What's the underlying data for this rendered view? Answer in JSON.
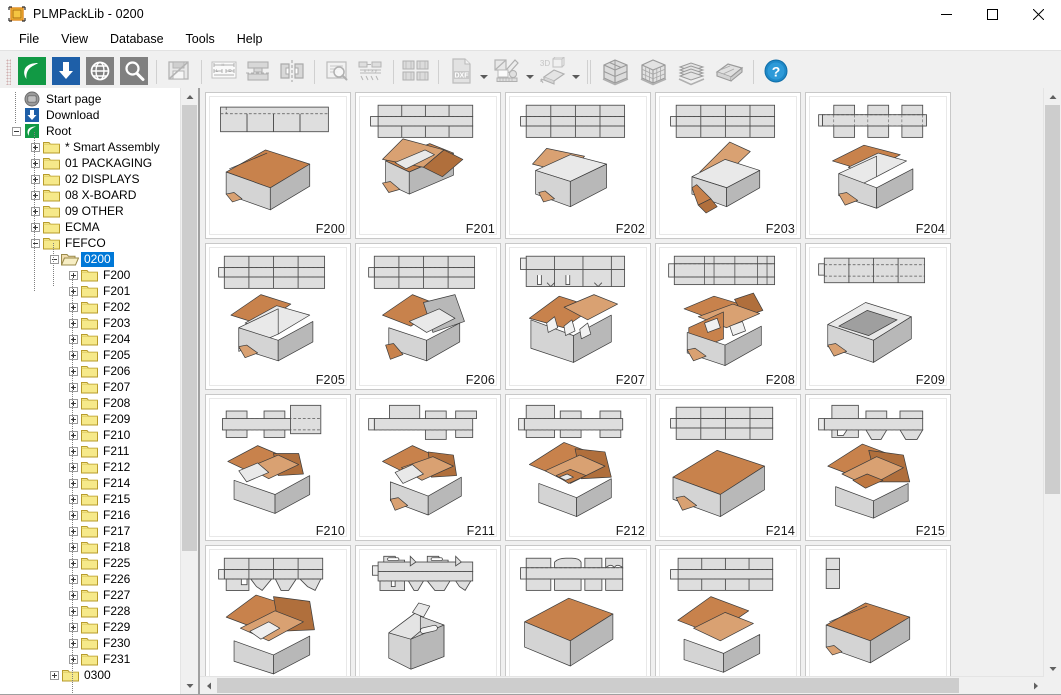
{
  "window": {
    "title": "PLMPackLib - 0200",
    "app_icon": "plmpack-logo-icon",
    "minimize_label": "Minimize",
    "maximize_label": "Maximize",
    "close_label": "Close"
  },
  "menu": {
    "items": [
      {
        "label": "File",
        "name": "menu-file"
      },
      {
        "label": "View",
        "name": "menu-view"
      },
      {
        "label": "Database",
        "name": "menu-database"
      },
      {
        "label": "Tools",
        "name": "menu-tools"
      },
      {
        "label": "Help",
        "name": "menu-help"
      }
    ]
  },
  "toolbar": {
    "buttons": [
      {
        "name": "leaf-home-button",
        "icon": "leaf-icon",
        "enabled": true
      },
      {
        "name": "download-button",
        "icon": "download-arrow-icon",
        "enabled": true
      },
      {
        "name": "web-browse-button",
        "icon": "globe-icon",
        "enabled": true
      },
      {
        "name": "search-button",
        "icon": "magnifier-icon",
        "enabled": true
      },
      {
        "name": "save-design-button",
        "icon": "save-disk-pencil-icon",
        "enabled": false
      },
      {
        "name": "dimension-parameters-button",
        "icon": "dimension-ruler-icon",
        "enabled": false
      },
      {
        "name": "assembly-button",
        "icon": "t-assembly-icon",
        "enabled": false
      },
      {
        "name": "mirror-button",
        "icon": "mirror-halves-icon",
        "enabled": false
      },
      {
        "name": "inspect-sheet-button",
        "icon": "sheet-magnifier-icon",
        "enabled": false
      },
      {
        "name": "production-setup-button",
        "icon": "production-grid-icon",
        "enabled": false
      },
      {
        "name": "imposition-button",
        "icon": "imposition-four-up-icon",
        "enabled": false
      },
      {
        "name": "export-dxf-button",
        "icon": "dxf-file-icon",
        "enabled": false
      },
      {
        "name": "export-dxf-dropdown",
        "icon": "chevron-down-icon",
        "enabled": false
      },
      {
        "name": "edit-drawing-button",
        "icon": "pencil-drawing-icon",
        "enabled": false
      },
      {
        "name": "edit-drawing-dropdown",
        "icon": "chevron-down-icon",
        "enabled": false
      },
      {
        "name": "three-d-view-button",
        "icon": "3d-fold-icon",
        "enabled": false
      },
      {
        "name": "three-d-view-dropdown",
        "icon": "chevron-down-icon",
        "enabled": false
      },
      {
        "name": "case-palletization-button",
        "icon": "case-block-icon",
        "enabled": false
      },
      {
        "name": "box-palletization-button",
        "icon": "box-stack-icon",
        "enabled": false
      },
      {
        "name": "pallet-layers-button",
        "icon": "pallet-layers-icon",
        "enabled": false
      },
      {
        "name": "bundle-button",
        "icon": "bundle-flat-icon",
        "enabled": false
      },
      {
        "name": "help-button",
        "icon": "help-question-icon",
        "enabled": true
      }
    ],
    "dxf_label": "DXF",
    "three_d_label": "3D"
  },
  "tree": {
    "selected": "0200",
    "nodes": [
      {
        "label": "Start page",
        "depth": 1,
        "icon": "start-page-icon",
        "expander": "none"
      },
      {
        "label": "Download",
        "depth": 1,
        "icon": "download-arrow-icon",
        "expander": "none"
      },
      {
        "label": "Root",
        "depth": 1,
        "icon": "leaf-icon",
        "expander": "minus"
      },
      {
        "label": "* Smart Assembly",
        "depth": 2,
        "icon": "folder-icon",
        "expander": "plus"
      },
      {
        "label": "01  PACKAGING",
        "depth": 2,
        "icon": "folder-icon",
        "expander": "plus"
      },
      {
        "label": "02  DISPLAYS",
        "depth": 2,
        "icon": "folder-icon",
        "expander": "plus"
      },
      {
        "label": "08  X-BOARD",
        "depth": 2,
        "icon": "folder-icon",
        "expander": "plus"
      },
      {
        "label": "09  OTHER",
        "depth": 2,
        "icon": "folder-icon",
        "expander": "plus"
      },
      {
        "label": "ECMA",
        "depth": 2,
        "icon": "folder-icon",
        "expander": "plus"
      },
      {
        "label": "FEFCO",
        "depth": 2,
        "icon": "folder-icon",
        "expander": "minus"
      },
      {
        "label": "0200",
        "depth": 3,
        "icon": "folder-open-icon",
        "expander": "minus",
        "selected": true
      },
      {
        "label": "F200",
        "depth": 4,
        "icon": "folder-icon",
        "expander": "plus"
      },
      {
        "label": "F201",
        "depth": 4,
        "icon": "folder-icon",
        "expander": "plus"
      },
      {
        "label": "F202",
        "depth": 4,
        "icon": "folder-icon",
        "expander": "plus"
      },
      {
        "label": "F203",
        "depth": 4,
        "icon": "folder-icon",
        "expander": "plus"
      },
      {
        "label": "F204",
        "depth": 4,
        "icon": "folder-icon",
        "expander": "plus"
      },
      {
        "label": "F205",
        "depth": 4,
        "icon": "folder-icon",
        "expander": "plus"
      },
      {
        "label": "F206",
        "depth": 4,
        "icon": "folder-icon",
        "expander": "plus"
      },
      {
        "label": "F207",
        "depth": 4,
        "icon": "folder-icon",
        "expander": "plus"
      },
      {
        "label": "F208",
        "depth": 4,
        "icon": "folder-icon",
        "expander": "plus"
      },
      {
        "label": "F209",
        "depth": 4,
        "icon": "folder-icon",
        "expander": "plus"
      },
      {
        "label": "F210",
        "depth": 4,
        "icon": "folder-icon",
        "expander": "plus"
      },
      {
        "label": "F211",
        "depth": 4,
        "icon": "folder-icon",
        "expander": "plus"
      },
      {
        "label": "F212",
        "depth": 4,
        "icon": "folder-icon",
        "expander": "plus"
      },
      {
        "label": "F214",
        "depth": 4,
        "icon": "folder-icon",
        "expander": "plus"
      },
      {
        "label": "F215",
        "depth": 4,
        "icon": "folder-icon",
        "expander": "plus"
      },
      {
        "label": "F216",
        "depth": 4,
        "icon": "folder-icon",
        "expander": "plus"
      },
      {
        "label": "F217",
        "depth": 4,
        "icon": "folder-icon",
        "expander": "plus"
      },
      {
        "label": "F218",
        "depth": 4,
        "icon": "folder-icon",
        "expander": "plus"
      },
      {
        "label": "F225",
        "depth": 4,
        "icon": "folder-icon",
        "expander": "plus"
      },
      {
        "label": "F226",
        "depth": 4,
        "icon": "folder-icon",
        "expander": "plus"
      },
      {
        "label": "F227",
        "depth": 4,
        "icon": "folder-icon",
        "expander": "plus"
      },
      {
        "label": "F228",
        "depth": 4,
        "icon": "folder-icon",
        "expander": "plus"
      },
      {
        "label": "F229",
        "depth": 4,
        "icon": "folder-icon",
        "expander": "plus"
      },
      {
        "label": "F230",
        "depth": 4,
        "icon": "folder-icon",
        "expander": "plus"
      },
      {
        "label": "F231",
        "depth": 4,
        "icon": "folder-icon",
        "expander": "plus"
      },
      {
        "label": "0300",
        "depth": 3,
        "icon": "folder-icon",
        "expander": "plus"
      }
    ]
  },
  "grid": {
    "items": [
      {
        "label": "F200",
        "shape": "fefco-0200-tray",
        "has_label": true
      },
      {
        "label": "F201",
        "shape": "fefco-0201-rsc-open",
        "has_label": true
      },
      {
        "label": "F202",
        "shape": "fefco-0202-osc",
        "has_label": true
      },
      {
        "label": "F203",
        "shape": "fefco-0203-flap",
        "has_label": true
      },
      {
        "label": "F204",
        "shape": "fefco-0204-overlap",
        "has_label": true
      },
      {
        "label": "F205",
        "shape": "fefco-0205-fol",
        "has_label": true
      },
      {
        "label": "F206",
        "shape": "fefco-0206-fol-open",
        "has_label": true
      },
      {
        "label": "F207",
        "shape": "fefco-0207-partition",
        "has_label": true
      },
      {
        "label": "F208",
        "shape": "fefco-0208-multi-flap",
        "has_label": true
      },
      {
        "label": "F209",
        "shape": "fefco-0209-rim",
        "has_label": true
      },
      {
        "label": "F210",
        "shape": "fefco-0210-rsc-small",
        "has_label": true
      },
      {
        "label": "F211",
        "shape": "fefco-0211-lid",
        "has_label": true
      },
      {
        "label": "F212",
        "shape": "fefco-0212-box",
        "has_label": true
      },
      {
        "label": "F214",
        "shape": "fefco-0214-open-tray",
        "has_label": true
      },
      {
        "label": "F215",
        "shape": "fefco-0215-insert",
        "has_label": true
      },
      {
        "label": "",
        "shape": "fefco-0216-insert-tray",
        "has_label": false
      },
      {
        "label": "",
        "shape": "fefco-0217-handle-box",
        "has_label": false
      },
      {
        "label": "",
        "shape": "fefco-0218-flap-open",
        "has_label": false
      },
      {
        "label": "",
        "shape": "fefco-0225-crate",
        "has_label": false
      },
      {
        "label": "",
        "shape": "fefco-0226-tray-open",
        "has_label": false
      }
    ]
  },
  "scrollbars": {
    "tree_vertical": {
      "name": "tree-vertical-scrollbar",
      "thumb_top_pct": 0,
      "thumb_height_pct": 78
    },
    "grid_vertical": {
      "name": "grid-vertical-scrollbar",
      "thumb_top_pct": 0,
      "thumb_height_pct": 70
    },
    "grid_horizontal": {
      "name": "grid-horizontal-scrollbar",
      "thumb_left_pct": 0,
      "thumb_width_pct": 92
    }
  },
  "colors": {
    "accent": "#0078d7",
    "board_brown": "#c87f49",
    "board_grey": "#d0d0d0",
    "folder_yellow": "#f2e07a",
    "leaf_green": "#119944",
    "download_blue": "#1e5fa8",
    "globe_grey": "#808080",
    "help_blue": "#1e88c7"
  }
}
